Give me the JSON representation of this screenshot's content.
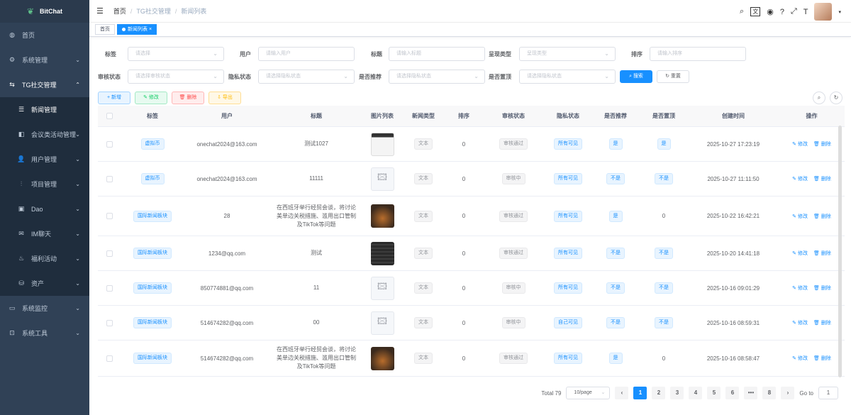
{
  "app": {
    "name": "BitChat"
  },
  "sidebar": {
    "items": [
      {
        "label": "首页",
        "icon": "dashboard-icon"
      },
      {
        "label": "系统管理",
        "icon": "gear-icon"
      },
      {
        "label": "TG社交管理",
        "icon": "social-icon"
      },
      {
        "label": "新闻管理",
        "icon": "news-icon"
      },
      {
        "label": "会议类活动管理",
        "icon": "meeting-icon"
      },
      {
        "label": "用户管理",
        "icon": "user-icon"
      },
      {
        "label": "项目管理",
        "icon": "project-icon"
      },
      {
        "label": "Dao",
        "icon": "dao-icon"
      },
      {
        "label": "IM聊天",
        "icon": "chat-icon"
      },
      {
        "label": "福利活动",
        "icon": "gift-icon"
      },
      {
        "label": "资产",
        "icon": "asset-icon"
      },
      {
        "label": "系统监控",
        "icon": "monitor-icon"
      },
      {
        "label": "系统工具",
        "icon": "tool-icon"
      }
    ]
  },
  "breadcrumb": {
    "home": "首页",
    "level1": "TG社交管理",
    "level2": "新闻列表"
  },
  "tags": {
    "home": "首页",
    "current": "新闻列表"
  },
  "filters": {
    "tag_label": "标签",
    "tag_placeholder": "请选择",
    "user_label": "用户",
    "user_placeholder": "请输入用户",
    "title_label": "标题",
    "title_placeholder": "请输入标题",
    "type_label": "呈现类型",
    "type_placeholder": "呈现类型",
    "sort_label": "排序",
    "sort_placeholder": "请输入排序",
    "audit_label": "审核状态",
    "audit_placeholder": "请选择审核状态",
    "privacy_label": "隐私状态",
    "privacy_placeholder": "请选择隐私状态",
    "recommend_label": "是否推荐",
    "recommend_placeholder": "请选择隐私状态",
    "top_label": "是否置顶",
    "top_placeholder": "请选择隐私状态",
    "search_btn": "搜索",
    "reset_btn": "重置"
  },
  "toolbar": {
    "add": "新增",
    "edit": "修改",
    "delete": "删除",
    "export": "导出"
  },
  "table": {
    "headers": [
      "标签",
      "用户",
      "标题",
      "图片列表",
      "新闻类型",
      "排序",
      "审核状态",
      "隐私状态",
      "是否推荐",
      "是否置顶",
      "创建时间",
      "操作"
    ],
    "edit_label": "修改",
    "delete_label": "删除",
    "rows": [
      {
        "tag": "虚拟币",
        "user": "onechat2024@163.com",
        "title": "测试1027",
        "img": "img-a",
        "type": "文本",
        "sort": "0",
        "audit": "审核通过",
        "privacy": "所有可见",
        "recommend": "是",
        "top": "是",
        "created": "2025-10-27 17:23:19"
      },
      {
        "tag": "虚拟币",
        "user": "onechat2024@163.com",
        "title": "11111",
        "img": "placeholder",
        "type": "文本",
        "sort": "0",
        "audit": "审核中",
        "privacy": "所有可见",
        "recommend": "不是",
        "top": "不是",
        "created": "2025-10-27 11:11:50"
      },
      {
        "tag": "国际新闻板块",
        "user": "28",
        "title": "在西班牙举行经贸会谈，将讨论美单边关税措施、滥用出口管制及TikTok等问题",
        "img": "img-b",
        "type": "文本",
        "sort": "0",
        "audit": "审核通过",
        "privacy": "所有可见",
        "recommend": "是",
        "top": "0",
        "created": "2025-10-22 16:42:21"
      },
      {
        "tag": "国际新闻板块",
        "user": "1234@qq.com",
        "title": "测试",
        "img": "img-c",
        "type": "文本",
        "sort": "0",
        "audit": "审核通过",
        "privacy": "所有可见",
        "recommend": "不是",
        "top": "不是",
        "created": "2025-10-20 14:41:18"
      },
      {
        "tag": "国际新闻板块",
        "user": "850774881@qq.com",
        "title": "11",
        "img": "placeholder",
        "type": "文本",
        "sort": "0",
        "audit": "审核中",
        "privacy": "所有可见",
        "recommend": "不是",
        "top": "不是",
        "created": "2025-10-16 09:01:29"
      },
      {
        "tag": "国际新闻板块",
        "user": "514674282@qq.com",
        "title": "00",
        "img": "placeholder",
        "type": "文本",
        "sort": "0",
        "audit": "审核中",
        "privacy": "自己可见",
        "recommend": "不是",
        "top": "不是",
        "created": "2025-10-16 08:59:31"
      },
      {
        "tag": "国际新闻板块",
        "user": "514674282@qq.com",
        "title": "在西班牙举行经贸会谈，将讨论美单边关税措施、滥用出口管制及TikTok等问题",
        "img": "img-b",
        "type": "文本",
        "sort": "0",
        "audit": "审核通过",
        "privacy": "所有可见",
        "recommend": "是",
        "top": "0",
        "created": "2025-10-16 08:58:47"
      }
    ]
  },
  "pagination": {
    "total": "Total 79",
    "page_size": "10/page",
    "pages": [
      "1",
      "2",
      "3",
      "4",
      "5",
      "6",
      "•••",
      "8"
    ],
    "current": "1",
    "goto_label": "Go to",
    "goto_value": "1"
  },
  "colors": {
    "primary": "#1890ff",
    "sidebar_bg": "#304156"
  }
}
